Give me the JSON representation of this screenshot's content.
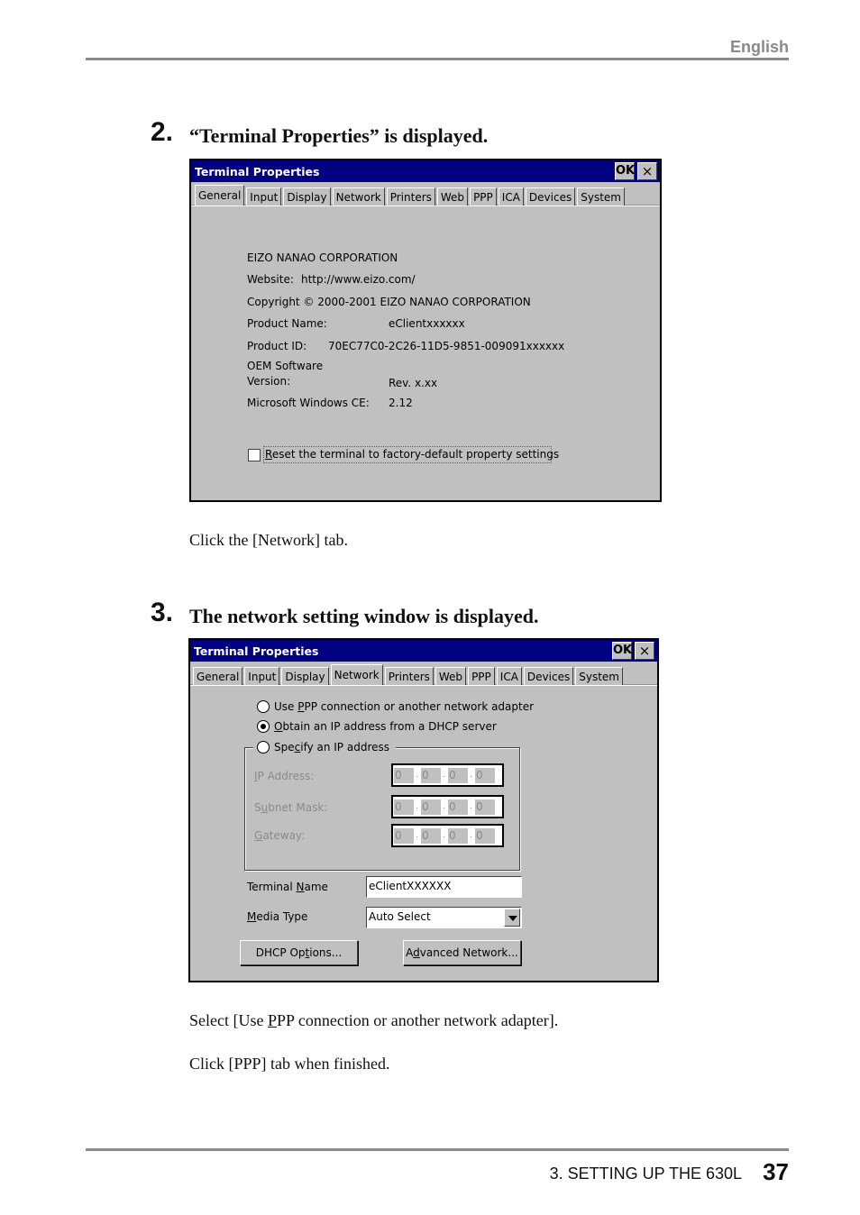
{
  "header": {
    "language": "English"
  },
  "steps": [
    {
      "number": "2.",
      "title": "“Terminal Properties” is displayed.",
      "instructions": [
        "Click the [Network] tab."
      ]
    },
    {
      "number": "3.",
      "title": "The network setting window is displayed.",
      "instructions": [
        {
          "pre": "Select [Use ",
          "ul": "P",
          "post": "PP connection or another network adapter]."
        },
        "Click [PPP] tab when finished."
      ]
    }
  ],
  "dialog_general": {
    "title": "Terminal Properties",
    "ok_label": "OK",
    "close_label": "×",
    "tabs": [
      "General",
      "Input",
      "Display",
      "Network",
      "Printers",
      "Web",
      "PPP",
      "ICA",
      "Devices",
      "System"
    ],
    "active_tab": "General",
    "company": "EIZO NANAO CORPORATION",
    "website_label": "Website:",
    "website_value": "http://www.eizo.com/",
    "copyright": "Copyright © 2000-2001 EIZO NANAO CORPORATION",
    "product_name_label": "Product Name:",
    "product_name_value": "eClientxxxxxx",
    "product_id_label": "Product ID:",
    "product_id_value": "70EC77C0-2C26-11D5-9851-009091xxxxxx",
    "oem_label_1": "OEM Software",
    "oem_label_2": "Version:",
    "oem_value": "Rev. x.xx",
    "wince_label": "Microsoft Windows CE:",
    "wince_value": "2.12",
    "reset_checkbox": {
      "ul": "R",
      "label": "eset the terminal to factory-default property settings",
      "checked": false
    }
  },
  "dialog_network": {
    "title": "Terminal Properties",
    "ok_label": "OK",
    "close_label": "×",
    "tabs": [
      "General",
      "Input",
      "Display",
      "Network",
      "Printers",
      "Web",
      "PPP",
      "ICA",
      "Devices",
      "System"
    ],
    "active_tab": "Network",
    "radios": [
      {
        "pre": "Use ",
        "ul": "P",
        "post": "PP connection or another network adapter",
        "selected": false
      },
      {
        "pre": "",
        "ul": "O",
        "post": "btain an IP address from a DHCP server",
        "selected": true
      },
      {
        "pre": "Spe",
        "ul": "c",
        "post": "ify an IP address",
        "selected": false
      }
    ],
    "ip_fields": [
      {
        "pre": "",
        "ul": "I",
        "post": "P Address:",
        "octets": [
          "0",
          "0",
          "0",
          "0"
        ]
      },
      {
        "pre": "S",
        "ul": "u",
        "post": "bnet Mask:",
        "octets": [
          "0",
          "0",
          "0",
          "0"
        ]
      },
      {
        "pre": "",
        "ul": "G",
        "post": "ateway:",
        "octets": [
          "0",
          "0",
          "0",
          "0"
        ]
      }
    ],
    "terminal_name": {
      "pre": "Terminal ",
      "ul": "N",
      "post": "ame",
      "value": "eClientXXXXXX"
    },
    "media_type": {
      "pre": "",
      "ul": "M",
      "post": "edia Type",
      "value": "Auto Select"
    },
    "dhcp_button": {
      "pre": "DHCP Op",
      "ul": "t",
      "post": "ions..."
    },
    "advanced_button": {
      "pre": "A",
      "ul": "d",
      "post": "vanced Network..."
    }
  },
  "footer": {
    "section": "3. SETTING UP THE 630L",
    "page": "37"
  }
}
